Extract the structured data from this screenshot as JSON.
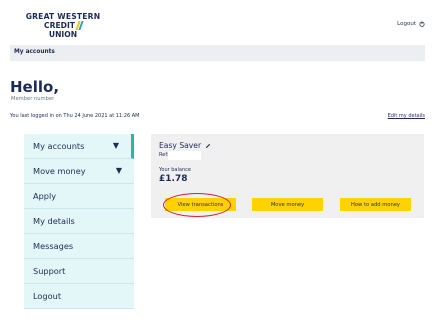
{
  "header": {
    "logo_line1": "GREAT WESTERN",
    "logo_line2": "CREDIT",
    "logo_line3": "UNION",
    "logout_label": "Logout",
    "logout_icon": "logout-icon"
  },
  "breadcrumb": {
    "label": "My accounts"
  },
  "greeting": {
    "title": "Hello,",
    "member_label": "Member number",
    "last_logged": "You last logged in on Thu 24 June 2021 at 11:26 AM",
    "edit_link": "Edit my details"
  },
  "nav": {
    "items": [
      {
        "label": "My accounts",
        "caret": "▼"
      },
      {
        "label": "Move money",
        "caret": "▼"
      },
      {
        "label": "Apply"
      },
      {
        "label": "My details"
      },
      {
        "label": "Messages"
      },
      {
        "label": "Support"
      },
      {
        "label": "Logout"
      }
    ]
  },
  "account": {
    "name": "Easy Saver",
    "edit_icon": "pencil-icon",
    "ref_label": "Ref:",
    "ref_value": "",
    "balance_label": "Your balance",
    "balance": "£1.78",
    "buttons": {
      "view_transactions": "View transactions",
      "move_money": "Move money",
      "how_to_add": "How to add money"
    }
  },
  "colors": {
    "brand_navy": "#1d2b57",
    "button_yellow": "#ffd200",
    "nav_bg": "#e3f7f9",
    "active_accent": "#27b7b0",
    "annotation_red": "#d4232b"
  }
}
